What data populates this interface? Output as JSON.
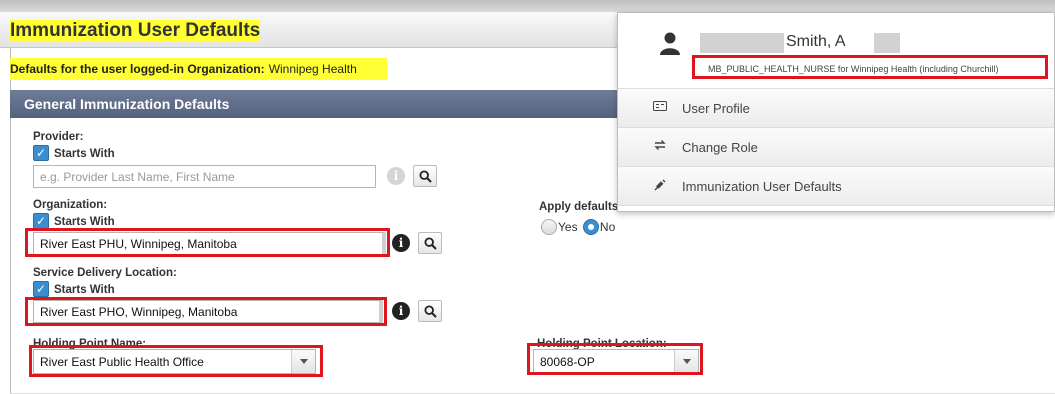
{
  "page": {
    "title": "Immunization User Defaults",
    "defaults_label": "Defaults for the user logged-in Organization:",
    "defaults_org": "Winnipeg Health",
    "section_title": "General Immunization Defaults"
  },
  "provider": {
    "label": "Provider:",
    "starts_with": "Starts With",
    "placeholder": "e.g. Provider Last Name, First Name"
  },
  "organization": {
    "label": "Organization:",
    "starts_with": "Starts With",
    "value": "River East PHU, Winnipeg, Manitoba"
  },
  "service_delivery": {
    "label": "Service Delivery Location:",
    "starts_with": "Starts With",
    "value": "River East PHO, Winnipeg, Manitoba"
  },
  "holding_point_name": {
    "label": "Holding Point Name:",
    "value": "River East Public Health Office"
  },
  "holding_point_location": {
    "label": "Holding Point Location:",
    "value": "80068-OP"
  },
  "historical": {
    "label": "Apply defaults to Historical Immunizations:",
    "yes": "Yes",
    "no": "No",
    "selected": "No"
  },
  "user_menu": {
    "name": "Smith, A",
    "role": "MB_PUBLIC_HEALTH_NURSE for Winnipeg Health (including Churchill)",
    "items": [
      {
        "label": "User Profile",
        "icon": "id-card-icon"
      },
      {
        "label": "Change Role",
        "icon": "swap-icon"
      },
      {
        "label": "Immunization User Defaults",
        "icon": "syringe-icon"
      }
    ]
  },
  "colors": {
    "highlight": "#ffff33",
    "annotation": "#e0141e",
    "section_header": "#5f6b88",
    "checkbox": "#3b8ed0"
  }
}
